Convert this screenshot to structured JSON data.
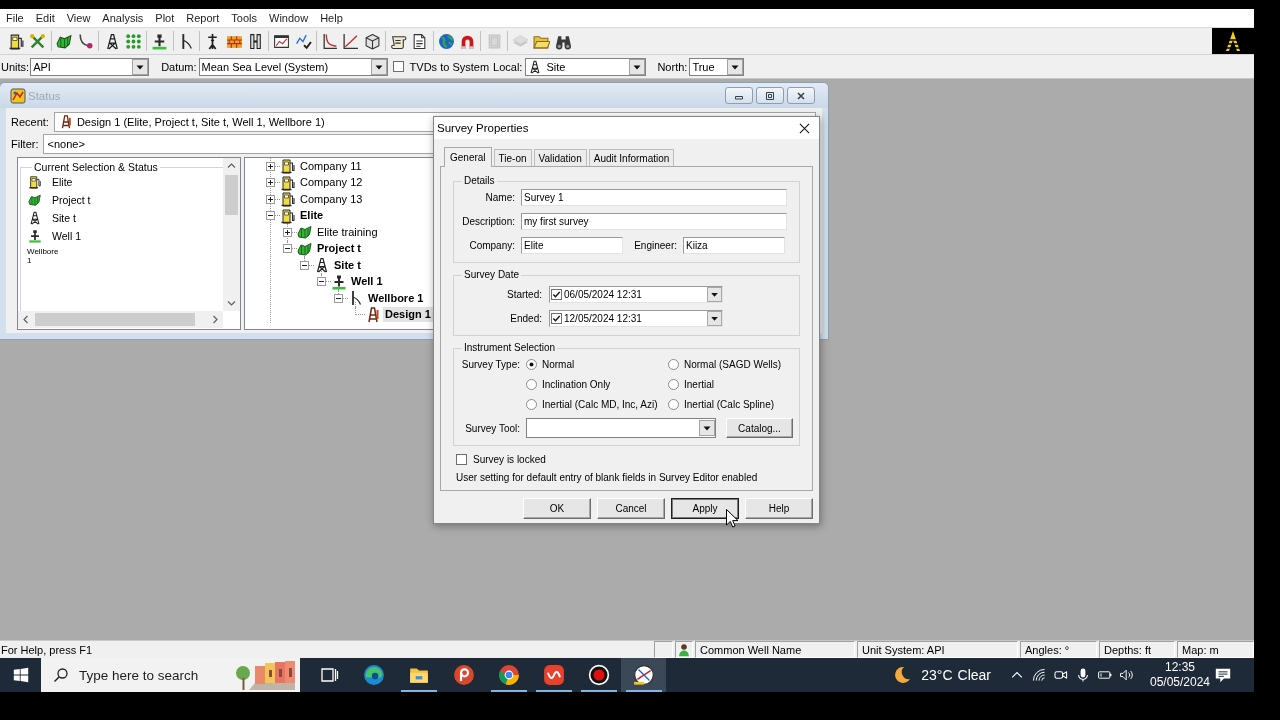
{
  "menu_bar": {
    "items": [
      "File",
      "Edit",
      "View",
      "Analysis",
      "Plot",
      "Report",
      "Tools",
      "Window",
      "Help"
    ]
  },
  "toolbar": {
    "buttons": [
      {
        "disabled": false
      },
      {
        "disabled": false
      },
      {
        "disabled": false
      },
      {
        "disabled": false
      },
      {
        "disabled": false
      },
      {
        "disabled": false
      },
      {
        "disabled": false
      },
      {
        "disabled": false
      },
      {
        "disabled": false
      },
      {
        "disabled": false
      },
      {
        "disabled": false
      },
      {
        "disabled": false
      },
      {
        "disabled": false
      },
      {
        "disabled": false
      },
      {
        "disabled": false
      },
      {
        "disabled": false
      },
      {
        "disabled": false
      },
      {
        "disabled": false
      },
      {
        "disabled": false
      },
      {
        "disabled": false
      },
      {
        "disabled": true
      },
      {
        "disabled": true
      },
      {
        "disabled": false
      },
      {
        "disabled": false
      }
    ]
  },
  "options_bar": {
    "units": {
      "label": "Units:",
      "value": "API"
    },
    "datum": {
      "label": "Datum:",
      "value": "Mean Sea Level (System)"
    },
    "tvds_to_system": {
      "label": "TVDs to System",
      "checked": false
    },
    "local": {
      "label": "Local:",
      "value": "Site"
    },
    "north": {
      "label": "North:",
      "value": "True"
    }
  },
  "status_window": {
    "title": "Status",
    "active": false,
    "recent": {
      "label": "Recent:",
      "value": "Design 1 (Elite, Project t, Site t, Well 1, Wellbore 1)"
    },
    "filter": {
      "label": "Filter:",
      "value": "<none>"
    },
    "current_selection": {
      "title": "Current Selection & Status",
      "items": [
        {
          "kind": "company",
          "label": "Elite"
        },
        {
          "kind": "project",
          "label": "Project t"
        },
        {
          "kind": "site",
          "label": "Site t"
        },
        {
          "kind": "well",
          "label": "Well 1"
        },
        {
          "kind": "plain",
          "label": "Wellbore 1"
        }
      ]
    },
    "tree": [
      {
        "kind": "company",
        "label": "Company 11",
        "expanded": false,
        "in_path": false,
        "selected": false
      },
      {
        "kind": "company",
        "label": "Company 12",
        "expanded": false,
        "in_path": false,
        "selected": false
      },
      {
        "kind": "company",
        "label": "Company 13",
        "expanded": false,
        "in_path": false,
        "selected": false
      },
      {
        "kind": "company",
        "label": "Elite",
        "expanded": true,
        "in_path": true,
        "selected": false,
        "children": [
          {
            "kind": "project",
            "label": "Elite training",
            "expanded": false,
            "in_path": false,
            "selected": false
          },
          {
            "kind": "project",
            "label": "Project t",
            "expanded": true,
            "in_path": true,
            "selected": false,
            "children": [
              {
                "kind": "site",
                "label": "Site t",
                "expanded": true,
                "in_path": true,
                "selected": false,
                "children": [
                  {
                    "kind": "well",
                    "label": "Well 1",
                    "expanded": true,
                    "in_path": true,
                    "selected": false,
                    "children": [
                      {
                        "kind": "wellbore",
                        "label": "Wellbore 1",
                        "expanded": true,
                        "in_path": true,
                        "selected": false,
                        "children": [
                          {
                            "kind": "design",
                            "label": "Design 1",
                            "in_path": true,
                            "selected": true
                          }
                        ]
                      }
                    ]
                  }
                ]
              }
            ]
          }
        ]
      }
    ]
  },
  "survey_dialog": {
    "title": "Survey Properties",
    "tabs": [
      {
        "label": "General",
        "selected": true
      },
      {
        "label": "Tie-on",
        "selected": false
      },
      {
        "label": "Validation",
        "selected": false
      },
      {
        "label": "Audit Information",
        "selected": false
      }
    ],
    "details": {
      "title": "Details",
      "name": {
        "label": "Name:",
        "value": "Survey 1"
      },
      "description": {
        "label": "Description:",
        "value": "my first survey"
      },
      "company": {
        "label": "Company:",
        "value": "Elite"
      },
      "engineer": {
        "label": "Engineer:",
        "value": "Kiiza"
      }
    },
    "survey_date": {
      "title": "Survey Date",
      "started": {
        "label": "Started:",
        "checked": true,
        "value": "06/05/2024 12:31"
      },
      "ended": {
        "label": "Ended:",
        "checked": true,
        "value": "12/05/2024 12:31"
      }
    },
    "instrument_selection": {
      "title": "Instrument Selection",
      "survey_type_label": "Survey Type:",
      "options": [
        {
          "label": "Normal",
          "selected": true
        },
        {
          "label": "Normal (SAGD Wells)",
          "selected": false
        },
        {
          "label": "Inclination Only",
          "selected": false
        },
        {
          "label": "Inertial",
          "selected": false
        },
        {
          "label": "Inertial (Calc MD, Inc, Azi)",
          "selected": false
        },
        {
          "label": "Inertial (Calc Spline)",
          "selected": false
        }
      ],
      "survey_tool_label": "Survey Tool:",
      "catalog_button": "Catalog..."
    },
    "locked": {
      "label": "Survey is locked",
      "checked": false
    },
    "note": "User setting for default entry of blank fields in Survey Editor enabled",
    "buttons": [
      {
        "label": "OK",
        "focused": false
      },
      {
        "label": "Cancel",
        "focused": false
      },
      {
        "label": "Apply",
        "focused": true
      },
      {
        "label": "Help",
        "focused": false
      }
    ]
  },
  "status_bar": {
    "help_text": "For Help, press F1",
    "panes": [
      "Common Well Name",
      "Unit System: API",
      "Angles: °",
      "Depths: ft",
      "Map: m"
    ]
  },
  "taskbar": {
    "search": {
      "placeholder": "Type here to search"
    },
    "apps": [
      {
        "running": false,
        "active": false
      },
      {
        "running": true,
        "active": false
      },
      {
        "running": false,
        "active": false
      },
      {
        "running": true,
        "active": false
      },
      {
        "running": true,
        "active": false
      },
      {
        "running": true,
        "active": false
      },
      {
        "running": true,
        "active": true
      }
    ],
    "weather": {
      "temperature": "23°C",
      "condition": "Clear"
    },
    "clock": {
      "time": "12:35",
      "date": "05/05/2024"
    }
  }
}
